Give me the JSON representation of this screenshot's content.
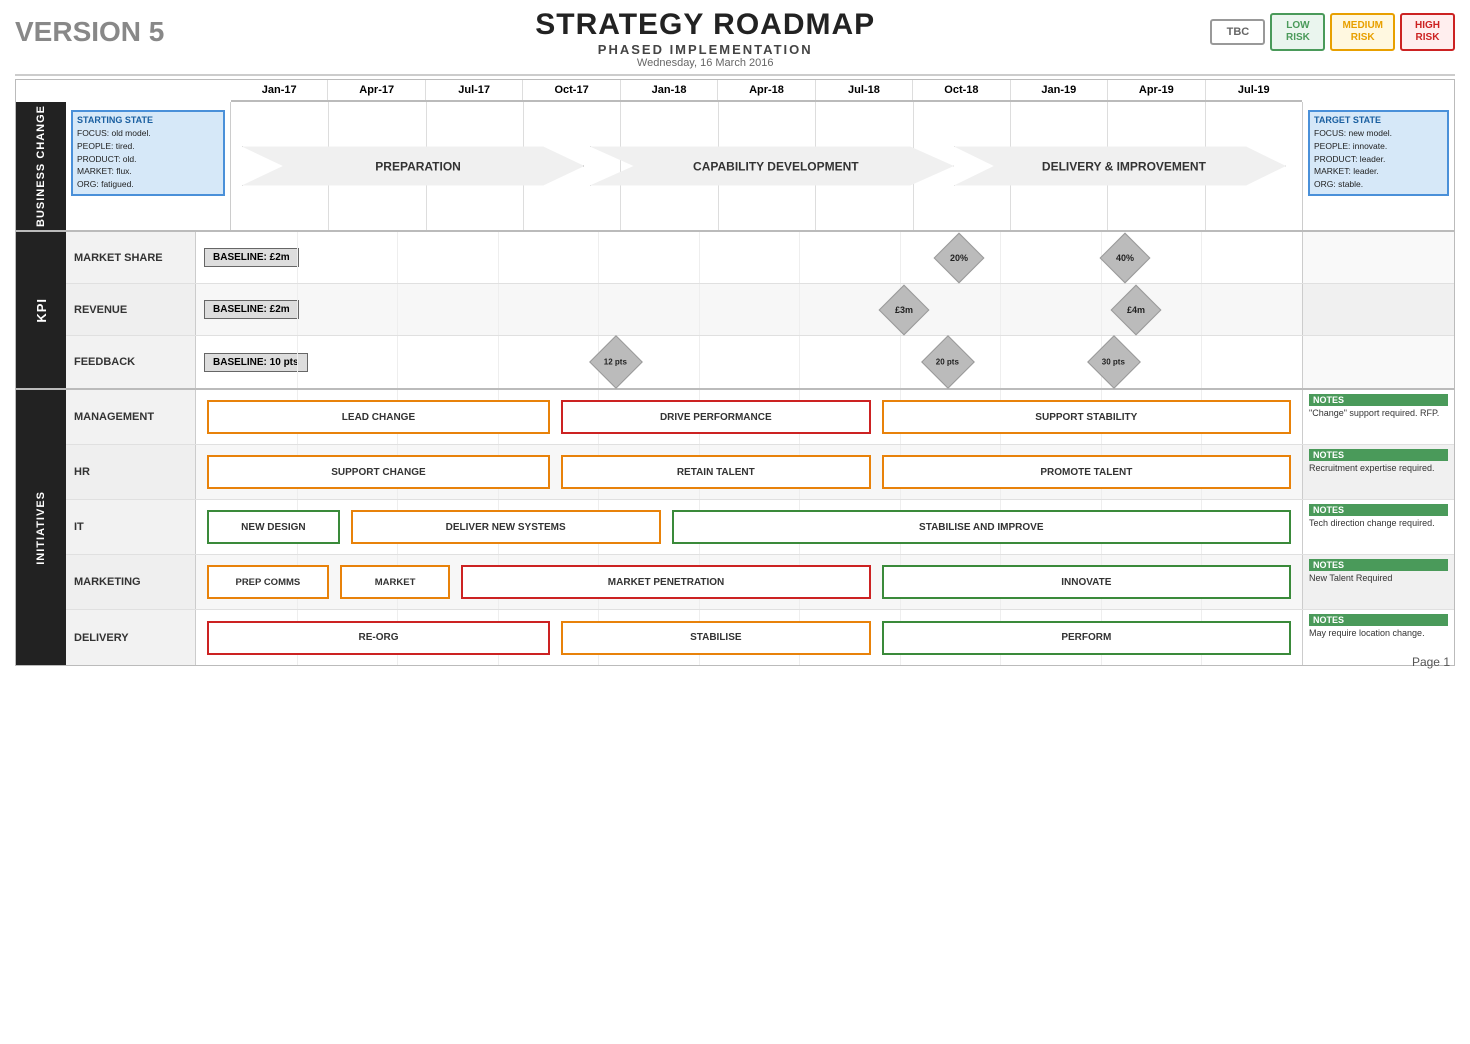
{
  "header": {
    "version": "VERSION 5",
    "title": "STRATEGY ROADMAP",
    "subtitle": "PHASED IMPLEMENTATION",
    "date": "Wednesday, 16 March 2016",
    "risk_legend": [
      {
        "label": "TBC",
        "class": "risk-tbc"
      },
      {
        "label": "LOW\nRISK",
        "class": "risk-low"
      },
      {
        "label": "MEDIUM\nRISK",
        "class": "risk-medium"
      },
      {
        "label": "HIGH\nRISK",
        "class": "risk-high"
      }
    ]
  },
  "timeline_cols": [
    "Jan-17",
    "Apr-17",
    "Jul-17",
    "Oct-17",
    "Jan-18",
    "Apr-18",
    "Jul-18",
    "Oct-18",
    "Jan-19",
    "Apr-19",
    "Jul-19"
  ],
  "business_change": {
    "starting_state": {
      "title": "STARTING STATE",
      "lines": [
        "FOCUS: old model.",
        "PEOPLE: tired.",
        "PRODUCT: old.",
        "MARKET: flux.",
        "ORG: fatigued."
      ]
    },
    "phases": [
      {
        "label": "PREPARATION",
        "start": 0,
        "span": 2
      },
      {
        "label": "CAPABILITY DEVELOPMENT",
        "start": 2,
        "span": 3
      },
      {
        "label": "DELIVERY & IMPROVEMENT",
        "start": 5,
        "span": 3
      }
    ],
    "target_state": {
      "title": "TARGET STATE",
      "lines": [
        "FOCUS: new model.",
        "PEOPLE: innovate.",
        "PRODUCT: leader.",
        "MARKET: leader.",
        "ORG: stable."
      ]
    }
  },
  "kpi": {
    "rows": [
      {
        "name": "MARKET SHARE",
        "baseline": "BASELINE: £2m",
        "milestones": [
          {
            "col": 7.5,
            "label": "20%"
          },
          {
            "col": 9.2,
            "label": "40%"
          }
        ]
      },
      {
        "name": "REVENUE",
        "baseline": "BASELINE: £2m",
        "milestones": [
          {
            "col": 7.0,
            "label": "£3m"
          },
          {
            "col": 9.3,
            "label": "£4m"
          }
        ]
      },
      {
        "name": "FEEDBACK",
        "baseline": "BASELINE: 10 pts",
        "milestones": [
          {
            "col": 4.2,
            "label": "12 pts"
          },
          {
            "col": 7.5,
            "label": "20 pts"
          },
          {
            "col": 9.2,
            "label": "30 pts"
          }
        ]
      }
    ]
  },
  "initiatives": {
    "rows": [
      {
        "name": "MANAGEMENT",
        "bars": [
          {
            "label": "LEAD CHANGE",
            "start": 0.05,
            "end": 3.5,
            "style": "orange"
          },
          {
            "label": "DRIVE PERFORMANCE",
            "start": 3.65,
            "end": 6.4,
            "style": "red"
          },
          {
            "label": "SUPPORT STABILITY",
            "start": 6.55,
            "end": 9.5,
            "style": "orange"
          }
        ],
        "notes_header": "NOTES",
        "notes_text": "\"Change\" support required. RFP."
      },
      {
        "name": "HR",
        "bars": [
          {
            "label": "SUPPORT CHANGE",
            "start": 0.05,
            "end": 3.5,
            "style": "orange"
          },
          {
            "label": "RETAIN TALENT",
            "start": 3.65,
            "end": 6.4,
            "style": "orange"
          },
          {
            "label": "PROMOTE TALENT",
            "start": 6.55,
            "end": 9.5,
            "style": "orange"
          }
        ],
        "notes_header": "NOTES",
        "notes_text": "Recruitment expertise required."
      },
      {
        "name": "IT",
        "bars": [
          {
            "label": "NEW DESIGN",
            "start": 0.05,
            "end": 1.4,
            "style": "green"
          },
          {
            "label": "DELIVER NEW SYSTEMS",
            "start": 1.55,
            "end": 4.4,
            "style": "orange"
          },
          {
            "label": "STABILISE AND IMPROVE",
            "start": 4.55,
            "end": 9.5,
            "style": "green"
          }
        ],
        "notes_header": "NOTES",
        "notes_text": "Tech direction change required."
      },
      {
        "name": "MARKETING",
        "bars": [
          {
            "label": "PREP COMMS",
            "start": 0.05,
            "end": 1.3,
            "style": "orange"
          },
          {
            "label": "MARKET",
            "start": 1.45,
            "end": 2.5,
            "style": "orange"
          },
          {
            "label": "MARKET PENETRATION",
            "start": 2.65,
            "end": 6.4,
            "style": "red"
          },
          {
            "label": "INNOVATE",
            "start": 6.55,
            "end": 9.5,
            "style": "green"
          }
        ],
        "notes_header": "NOTES",
        "notes_text": "New Talent Required"
      },
      {
        "name": "DELIVERY",
        "bars": [
          {
            "label": "RE-ORG",
            "start": 0.05,
            "end": 3.5,
            "style": "red"
          },
          {
            "label": "STABILISE",
            "start": 3.65,
            "end": 6.4,
            "style": "orange"
          },
          {
            "label": "PERFORM",
            "start": 6.55,
            "end": 9.5,
            "style": "green"
          }
        ],
        "notes_header": "NOTES",
        "notes_text": "May require location change."
      }
    ]
  },
  "page_number": "Page 1"
}
